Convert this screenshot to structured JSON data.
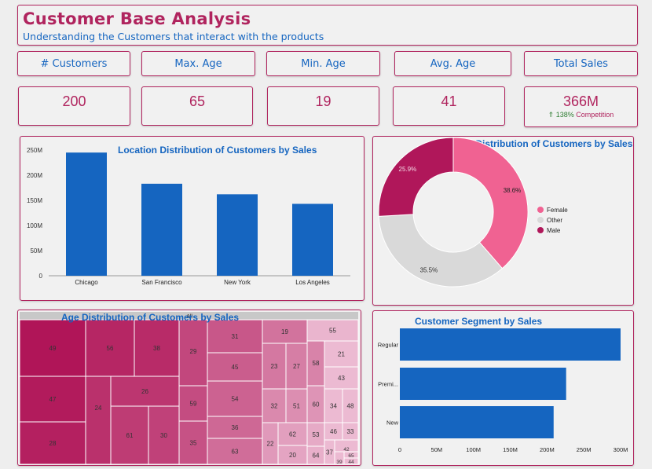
{
  "header": {
    "title": "Customer Base Analysis",
    "subtitle": "Understanding the Customers that interact with the products"
  },
  "kpis": [
    {
      "label": "# Customers",
      "value": "200"
    },
    {
      "label": "Max. Age",
      "value": "65"
    },
    {
      "label": "Min. Age",
      "value": "19"
    },
    {
      "label": "Avg. Age",
      "value": "41"
    },
    {
      "label": "Total Sales",
      "value": "366M",
      "delta": "138%",
      "delta_label": "Competition"
    }
  ],
  "colors": {
    "accent": "#b0245e",
    "blue": "#1565c0",
    "female": "#f06292",
    "other": "#d9d9d9",
    "male": "#b0175a"
  },
  "chart_data": [
    {
      "type": "bar",
      "title": "Location Distribution of Customers by Sales",
      "categories": [
        "Chicago",
        "San Francisco",
        "New York",
        "Los Angeles"
      ],
      "values": [
        245,
        183,
        162,
        143
      ],
      "unit": "M",
      "ylim": [
        0,
        250
      ],
      "yticks": [
        "0",
        "50M",
        "100M",
        "150M",
        "200M",
        "250M"
      ],
      "grid": false,
      "color": "#1565c0"
    },
    {
      "type": "pie",
      "donut": true,
      "title": "Gender Distribution of Customers by Sales",
      "labels": [
        "Female",
        "Other",
        "Male"
      ],
      "values": [
        38.6,
        35.5,
        25.9
      ],
      "value_labels": [
        "38.6%",
        "35.5%",
        "25.9%"
      ],
      "colors": [
        "#f06292",
        "#d9d9d9",
        "#b0175a"
      ],
      "legend": "right"
    },
    {
      "type": "treemap",
      "title": "Age Distribution of Customers by Sales",
      "root_label": "All",
      "cells": [
        "49",
        "47",
        "28",
        "56",
        "38",
        "24",
        "26",
        "61",
        "30",
        "29",
        "59",
        "35",
        "31",
        "45",
        "54",
        "36",
        "63",
        "19",
        "23",
        "27",
        "58",
        "32",
        "51",
        "60",
        "22",
        "62",
        "20",
        "53",
        "64",
        "55",
        "21",
        "43",
        "34",
        "48",
        "46",
        "33",
        "42",
        "37",
        "39",
        "65",
        "44"
      ]
    },
    {
      "type": "bar",
      "orientation": "horizontal",
      "title": "Customer Segment by Sales",
      "categories": [
        "Regular",
        "Premi...",
        "New"
      ],
      "values": [
        300,
        226,
        209
      ],
      "unit": "M",
      "xlim": [
        0,
        300
      ],
      "xticks": [
        "0",
        "50M",
        "100M",
        "150M",
        "200M",
        "250M",
        "300M"
      ],
      "color": "#1565c0"
    }
  ]
}
